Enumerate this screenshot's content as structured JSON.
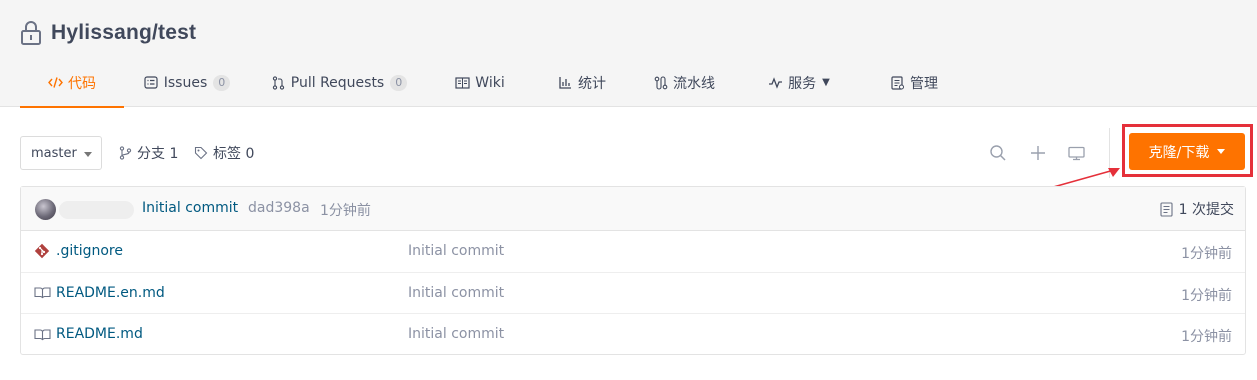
{
  "repo": {
    "title": "Hylissang/test"
  },
  "tabs": [
    {
      "label": "代码",
      "icon": "code-icon",
      "active": true
    },
    {
      "label": "Issues",
      "icon": "issues-icon",
      "count": "0"
    },
    {
      "label": "Pull Requests",
      "icon": "pull-request-icon",
      "count": "0"
    },
    {
      "label": "Wiki",
      "icon": "wiki-icon"
    },
    {
      "label": "统计",
      "icon": "stats-icon"
    },
    {
      "label": "流水线",
      "icon": "pipeline-icon"
    },
    {
      "label": "服务",
      "icon": "service-icon",
      "has_dropdown": true
    },
    {
      "label": "管理",
      "icon": "manage-icon"
    }
  ],
  "toolbar": {
    "branch": "master",
    "branches_label": "分支 1",
    "tags_label": "标签 0",
    "clone_label": "克隆/下载",
    "icons": [
      "search-icon",
      "plus-icon",
      "monitor-icon"
    ]
  },
  "commit": {
    "message": "Initial commit",
    "sha": "dad398a",
    "time": "1分钟前",
    "count_label": "1 次提交"
  },
  "files": [
    {
      "name": ".gitignore",
      "icon": "git-file-icon",
      "message": "Initial commit",
      "time": "1分钟前"
    },
    {
      "name": "README.en.md",
      "icon": "book-icon",
      "message": "Initial commit",
      "time": "1分钟前"
    },
    {
      "name": "README.md",
      "icon": "book-icon",
      "message": "Initial commit",
      "time": "1分钟前"
    }
  ],
  "colors": {
    "accent": "#fe7300",
    "link": "#005980",
    "highlight": "#e5303a",
    "muted": "#8c92a4"
  }
}
